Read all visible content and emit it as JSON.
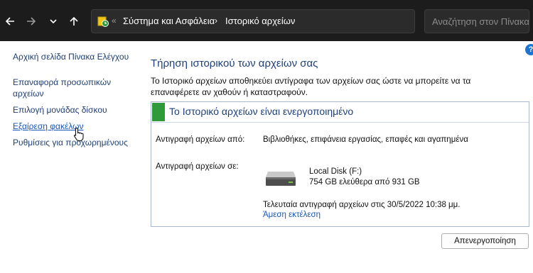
{
  "address_bar": {
    "overflow": "«",
    "crumbs": [
      "Σύστημα και Ασφάλεια",
      "Ιστορικό αρχείων"
    ],
    "separator": "›"
  },
  "search": {
    "placeholder": "Αναζήτηση στον Πίνακα Ελέγχου"
  },
  "sidebar": {
    "items": [
      {
        "label": "Αρχική σελίδα Πίνακα Ελέγχου"
      },
      {
        "label": "Επαναφορά προσωπικών αρχείων"
      },
      {
        "label": "Επιλογή μονάδας δίσκου"
      },
      {
        "label": "Εξαίρεση φακέλων"
      },
      {
        "label": "Ρυθμίσεις για προχωρημένους"
      }
    ]
  },
  "help": "?",
  "main": {
    "title": "Τήρηση ιστορικού των αρχείων σας",
    "description": "Το Ιστορικό αρχείων αποθηκεύει αντίγραφα των αρχείων σας ώστε να μπορείτε να τα επαναφέρετε αν χαθούν ή καταστραφούν.",
    "status_title": "Το Ιστορικό αρχείων είναι ενεργοποιημένο",
    "copy_from_label": "Αντιγραφή αρχείων από:",
    "copy_from_value": "Βιβλιοθήκες, επιφάνεια εργασίας, επαφές και αγαπημένα",
    "copy_to_label": "Αντιγραφή αρχείων σε:",
    "drive_name": "Local Disk (F:)",
    "drive_space": "754 GB ελεύθερα από 931 GB",
    "last_copy": "Τελευταία αντιγραφή αρχείων στις 30/5/2022 10:38 μμ.",
    "run_now": "Άμεση εκτέλεση",
    "disable_button": "Απενεργοποίηση"
  }
}
